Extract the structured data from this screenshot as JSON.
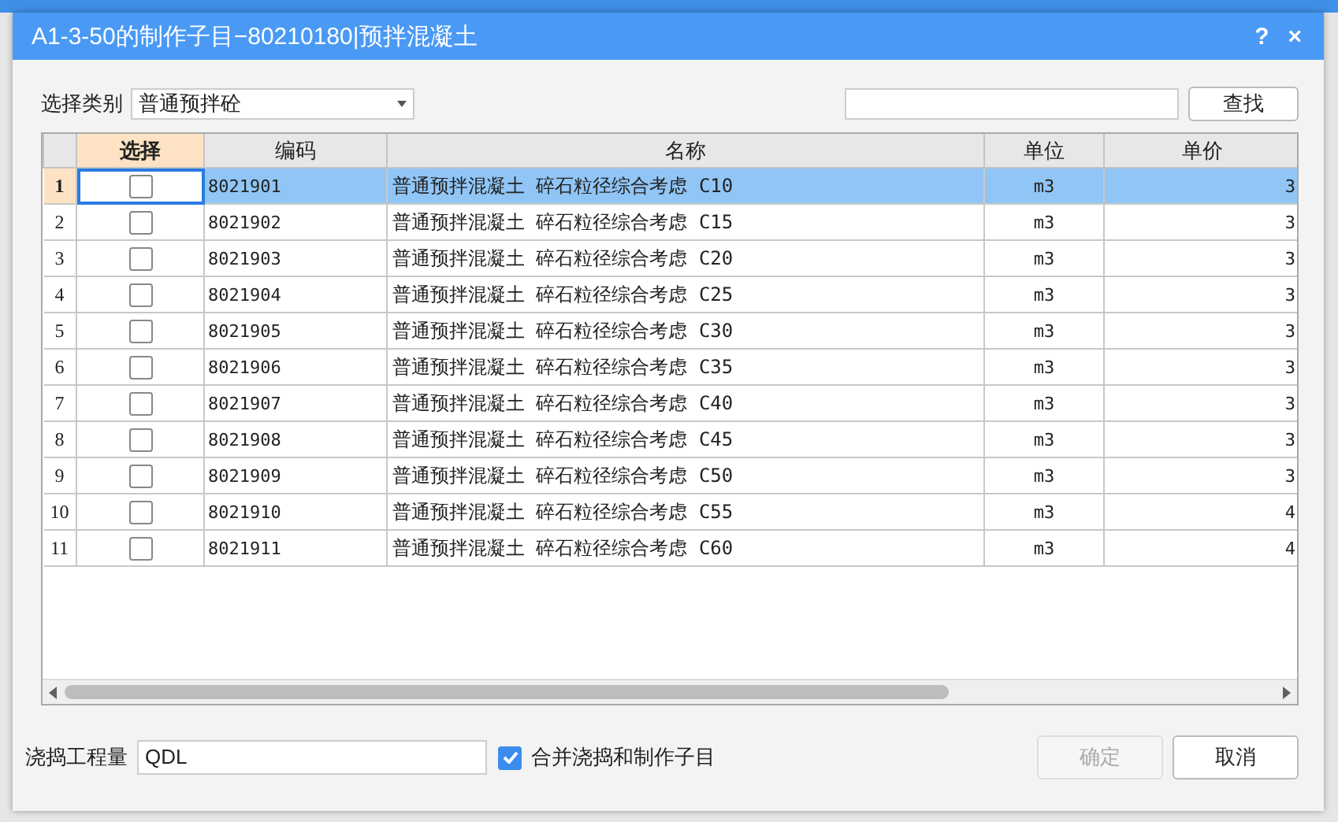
{
  "dialog": {
    "title": "A1-3-50的制作子目−80210180|预拌混凝土",
    "help": "?",
    "close": "×"
  },
  "category": {
    "label": "选择类别",
    "value": "普通预拌砼"
  },
  "search": {
    "button": "查找"
  },
  "table": {
    "columns": [
      {
        "label": "选择",
        "selected": true
      },
      {
        "label": "编码",
        "selected": false
      },
      {
        "label": "名称",
        "selected": false
      },
      {
        "label": "单位",
        "selected": false
      },
      {
        "label": "单价",
        "selected": false
      }
    ],
    "rows": [
      {
        "number": "1",
        "selected": true,
        "checked": false,
        "code": "8021901",
        "name": "普通预拌混凝土 碎石粒径综合考虑 C10",
        "unit": "m3",
        "price": "3"
      },
      {
        "number": "2",
        "selected": false,
        "checked": false,
        "code": "8021902",
        "name": "普通预拌混凝土 碎石粒径综合考虑 C15",
        "unit": "m3",
        "price": "3"
      },
      {
        "number": "3",
        "selected": false,
        "checked": false,
        "code": "8021903",
        "name": "普通预拌混凝土 碎石粒径综合考虑 C20",
        "unit": "m3",
        "price": "3"
      },
      {
        "number": "4",
        "selected": false,
        "checked": false,
        "code": "8021904",
        "name": "普通预拌混凝土 碎石粒径综合考虑 C25",
        "unit": "m3",
        "price": "3"
      },
      {
        "number": "5",
        "selected": false,
        "checked": false,
        "code": "8021905",
        "name": "普通预拌混凝土 碎石粒径综合考虑 C30",
        "unit": "m3",
        "price": "3"
      },
      {
        "number": "6",
        "selected": false,
        "checked": false,
        "code": "8021906",
        "name": "普通预拌混凝土 碎石粒径综合考虑 C35",
        "unit": "m3",
        "price": "3"
      },
      {
        "number": "7",
        "selected": false,
        "checked": false,
        "code": "8021907",
        "name": "普通预拌混凝土 碎石粒径综合考虑 C40",
        "unit": "m3",
        "price": "3"
      },
      {
        "number": "8",
        "selected": false,
        "checked": false,
        "code": "8021908",
        "name": "普通预拌混凝土 碎石粒径综合考虑 C45",
        "unit": "m3",
        "price": "3"
      },
      {
        "number": "9",
        "selected": false,
        "checked": false,
        "code": "8021909",
        "name": "普通预拌混凝土 碎石粒径综合考虑 C50",
        "unit": "m3",
        "price": "3"
      },
      {
        "number": "10",
        "selected": false,
        "checked": false,
        "code": "8021910",
        "name": "普通预拌混凝土 碎石粒径综合考虑 C55",
        "unit": "m3",
        "price": "4"
      },
      {
        "number": "11",
        "selected": false,
        "checked": false,
        "code": "8021911",
        "name": "普通预拌混凝土 碎石粒径综合考虑 C60",
        "unit": "m3",
        "price": "4"
      }
    ]
  },
  "quantity": {
    "label": "浇捣工程量",
    "value": "QDL"
  },
  "merge": {
    "label": "合并浇捣和制作子目",
    "checked": true
  },
  "buttons": [
    {
      "label": "确定",
      "disabled": true
    },
    {
      "label": "取消",
      "disabled": false
    }
  ]
}
